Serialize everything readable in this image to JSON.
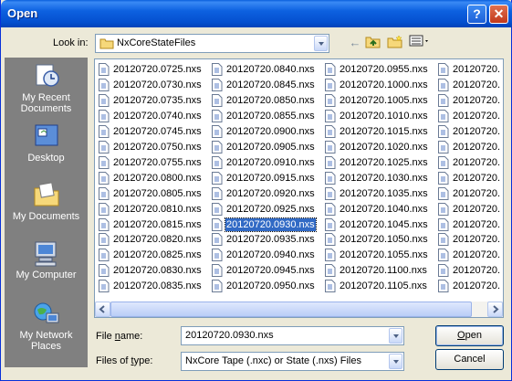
{
  "title": "Open",
  "title_buttons": {
    "help": "?",
    "close": "✕"
  },
  "look_in": {
    "label": "Look in:",
    "value": "NxCoreStateFiles"
  },
  "places": [
    {
      "label_line1": "My Recent",
      "label_line2": "Documents",
      "icon": "recent-documents-icon"
    },
    {
      "label_line1": "Desktop",
      "label_line2": "",
      "icon": "desktop-icon"
    },
    {
      "label_line1": "My Documents",
      "label_line2": "",
      "icon": "my-documents-icon"
    },
    {
      "label_line1": "My Computer",
      "label_line2": "",
      "icon": "my-computer-icon"
    },
    {
      "label_line1": "My Network",
      "label_line2": "Places",
      "icon": "network-places-icon"
    }
  ],
  "files": [
    [
      "20120720.0725.nxs",
      "20120720.0730.nxs",
      "20120720.0735.nxs",
      "20120720.0740.nxs",
      "20120720.0745.nxs",
      "20120720.0750.nxs",
      "20120720.0755.nxs",
      "20120720.0800.nxs",
      "20120720.0805.nxs",
      "20120720.0810.nxs",
      "20120720.0815.nxs",
      "20120720.0820.nxs",
      "20120720.0825.nxs",
      "20120720.0830.nxs",
      "20120720.0835.nxs"
    ],
    [
      "20120720.0840.nxs",
      "20120720.0845.nxs",
      "20120720.0850.nxs",
      "20120720.0855.nxs",
      "20120720.0900.nxs",
      "20120720.0905.nxs",
      "20120720.0910.nxs",
      "20120720.0915.nxs",
      "20120720.0920.nxs",
      "20120720.0925.nxs",
      "20120720.0930.nxs",
      "20120720.0935.nxs",
      "20120720.0940.nxs",
      "20120720.0945.nxs",
      "20120720.0950.nxs"
    ],
    [
      "20120720.0955.nxs",
      "20120720.1000.nxs",
      "20120720.1005.nxs",
      "20120720.1010.nxs",
      "20120720.1015.nxs",
      "20120720.1020.nxs",
      "20120720.1025.nxs",
      "20120720.1030.nxs",
      "20120720.1035.nxs",
      "20120720.1040.nxs",
      "20120720.1045.nxs",
      "20120720.1050.nxs",
      "20120720.1055.nxs",
      "20120720.1100.nxs",
      "20120720.1105.nxs"
    ],
    [
      "20120720.",
      "20120720.",
      "20120720.",
      "20120720.",
      "20120720.",
      "20120720.",
      "20120720.",
      "20120720.",
      "20120720.",
      "20120720.",
      "20120720.",
      "20120720.",
      "20120720.",
      "20120720.",
      "20120720."
    ]
  ],
  "selected_file": "20120720.0930.nxs",
  "file_name": {
    "label_pre": "File ",
    "label_acc": "n",
    "label_post": "ame:",
    "value": "20120720.0930.nxs"
  },
  "file_type": {
    "label_pre": "Files of ",
    "label_acc": "t",
    "label_post": "ype:",
    "value": "NxCore Tape (.nxc) or State (.nxs) Files"
  },
  "buttons": {
    "open_acc": "O",
    "open_rest": "pen",
    "cancel": "Cancel"
  },
  "colors": {
    "title_bar": "#0550d0",
    "selection": "#316ac5",
    "places_bar": "#808080",
    "dialog_bg": "#ece9d8"
  }
}
